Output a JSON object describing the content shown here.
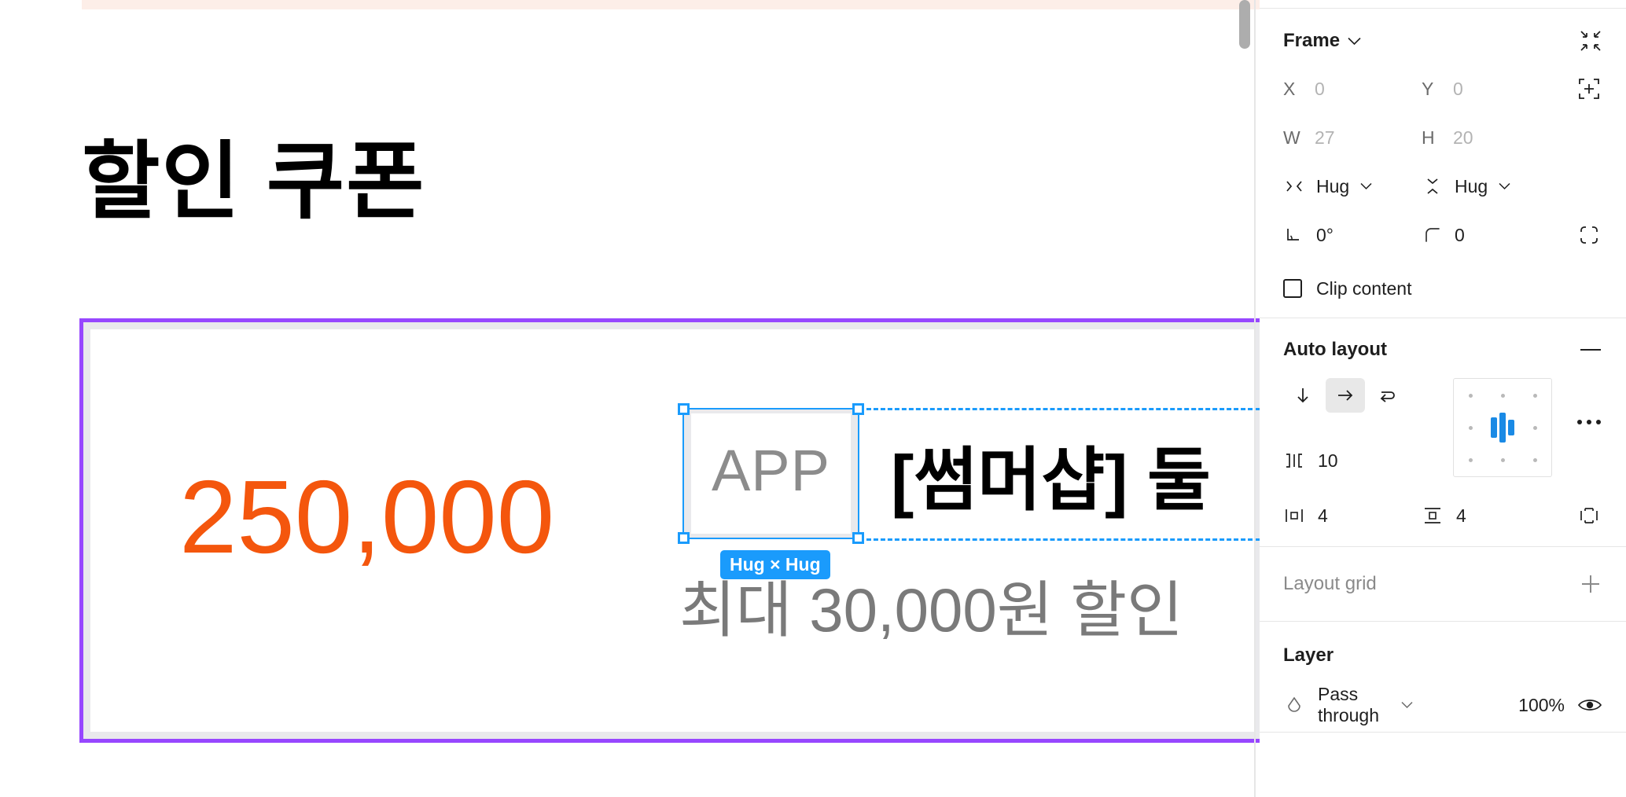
{
  "canvas": {
    "title": "할인 쿠폰",
    "price": "250,000",
    "app_chip_label": "APP",
    "hug_badge": "Hug × Hug",
    "promo_title": "[썸머샵] 둘",
    "promo_sub": "최대 30,000원 할인",
    "colors": {
      "price_orange": "#F4560D",
      "frame_purple": "#9747FF",
      "selection_blue": "#1A9BFC",
      "sub_gray": "#7A7A7A"
    }
  },
  "panel": {
    "frame": {
      "title": "Frame",
      "collapse_icon": "collapse-icon",
      "x_label": "X",
      "x_value": "0",
      "y_label": "Y",
      "y_value": "0",
      "align_icon": "align-to-pixel-grid-icon",
      "w_label": "W",
      "w_value": "27",
      "h_label": "H",
      "h_value": "20",
      "resize_w_icon": "horizontal-resizing-icon",
      "resize_w_value": "Hug",
      "resize_h_icon": "vertical-resizing-icon",
      "resize_h_value": "Hug",
      "rotation_icon": "rotation-icon",
      "rotation_value": "0°",
      "corner_icon": "corner-radius-icon",
      "corner_value": "0",
      "independent_corners_icon": "independent-corners-icon",
      "clip_content_label": "Clip content",
      "clip_content_checked": false
    },
    "auto_layout": {
      "title": "Auto layout",
      "remove_icon": "minus-icon",
      "direction_vertical_icon": "arrow-down-icon",
      "direction_horizontal_icon": "arrow-right-icon",
      "direction_wrap_icon": "wrap-icon",
      "direction_selected": "horizontal",
      "gap_icon": "gap-between-icon",
      "gap_value": "10",
      "padding_horizontal_icon": "horizontal-padding-icon",
      "padding_horizontal_value": "4",
      "padding_vertical_icon": "vertical-padding-icon",
      "padding_vertical_value": "4",
      "individual_padding_icon": "individual-padding-icon",
      "alignment_icon": "alignment-grid",
      "more_options_icon": "more-options-icon"
    },
    "layout_grid": {
      "title": "Layout grid",
      "add_icon": "plus-icon"
    },
    "layer": {
      "title": "Layer",
      "blend_icon": "blend-mode-icon",
      "blend_mode": "Pass through",
      "opacity": "100%",
      "visibility_icon": "eye-icon"
    }
  }
}
